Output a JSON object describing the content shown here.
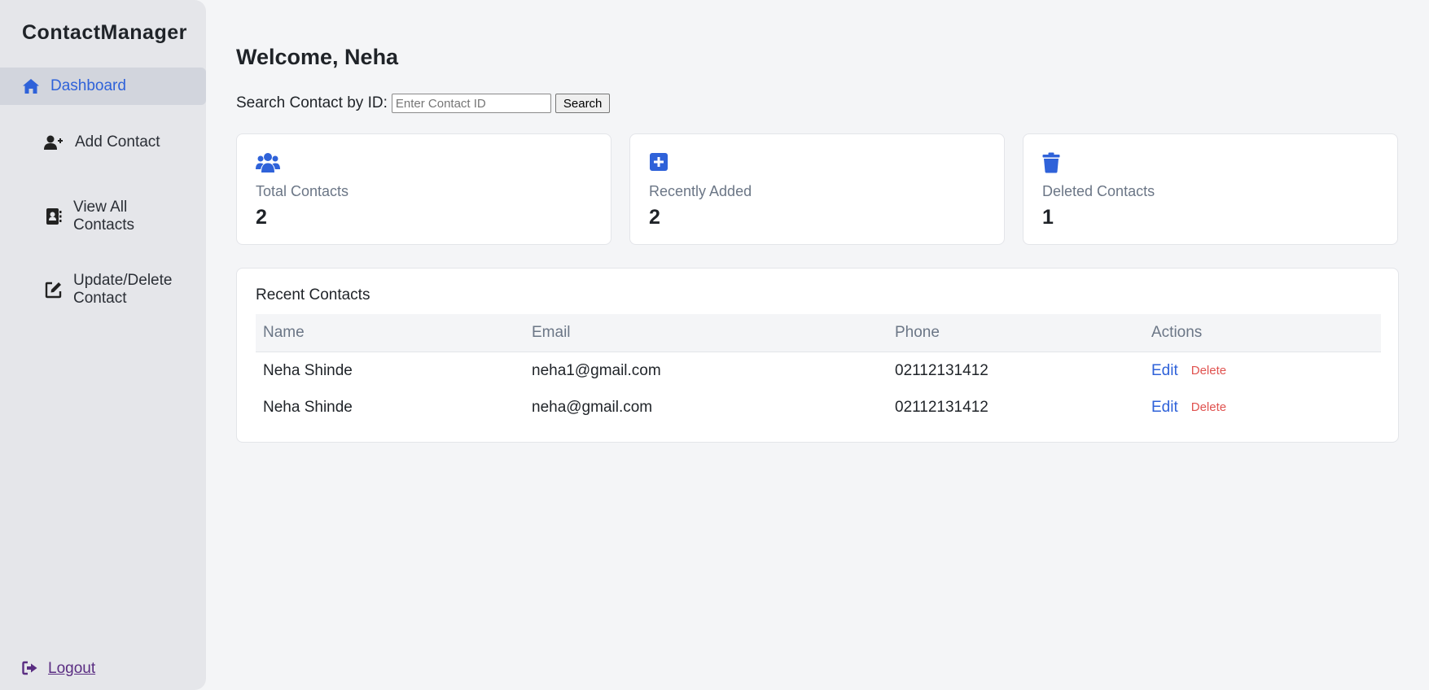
{
  "app": {
    "brand": "ContactManager"
  },
  "sidebar": {
    "items": [
      {
        "label": "Dashboard",
        "icon": "home-icon",
        "active": true
      },
      {
        "label": "Add Contact",
        "icon": "user-plus-icon"
      },
      {
        "label": "View All Contacts",
        "icon": "address-book-icon"
      },
      {
        "label": "Update/Delete Contact",
        "icon": "edit-icon"
      }
    ],
    "logout": {
      "label": "Logout",
      "icon": "logout-icon"
    }
  },
  "main": {
    "welcome": "Welcome, Neha",
    "search": {
      "label": "Search Contact by ID:",
      "placeholder": "Enter Contact ID",
      "value": "",
      "button": "Search"
    },
    "cards": [
      {
        "label": "Total Contacts",
        "value": "2",
        "icon": "users-icon"
      },
      {
        "label": "Recently Added",
        "value": "2",
        "icon": "plus-square-icon"
      },
      {
        "label": "Deleted Contacts",
        "value": "1",
        "icon": "trash-icon"
      }
    ],
    "recent": {
      "title": "Recent Contacts",
      "columns": [
        "Name",
        "Email",
        "Phone",
        "Actions"
      ],
      "rows": [
        {
          "name": "Neha Shinde",
          "email": "neha1@gmail.com",
          "phone": "02112131412",
          "edit": "Edit",
          "delete": "Delete"
        },
        {
          "name": "Neha Shinde",
          "email": "neha@gmail.com",
          "phone": "02112131412",
          "edit": "Edit",
          "delete": "Delete"
        }
      ]
    }
  },
  "colors": {
    "accent": "#2f62d9",
    "danger": "#e0524f",
    "sidebar_bg": "#e5e6ea",
    "active_bg": "#d2d5dd",
    "logout": "#5a2d82"
  }
}
